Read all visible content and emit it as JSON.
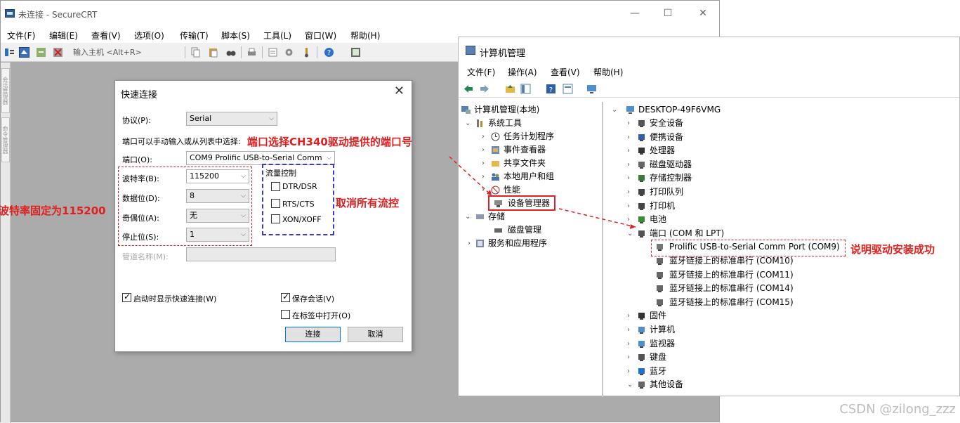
{
  "crt": {
    "title": "未连接 - SecureCRT",
    "window_controls": {
      "minimize": "—",
      "maximize": "☐",
      "close": "✕"
    },
    "menu": [
      "文件(F)",
      "编辑(E)",
      "查看(V)",
      "选项(O)",
      "传输(T)",
      "脚本(S)",
      "工具(L)",
      "窗口(W)",
      "帮助(H)"
    ],
    "host_input_placeholder": "输入主机 <Alt+R>",
    "rail_tabs": [
      "会话管理器",
      "命令管理器"
    ]
  },
  "dialog": {
    "title": "快速连接",
    "close": "✕",
    "protocol_label": "协议(P):",
    "protocol_value": "Serial",
    "port_hint": "端口可以手动输入或从列表中选择:",
    "port_label": "端口(O):",
    "port_value": "COM9 Prolific USB-to-Serial Comm P",
    "baud_label": "波特率(B):",
    "baud_value": "115200",
    "databits_label": "数据位(D):",
    "databits_value": "8",
    "parity_label": "奇偶位(A):",
    "parity_value": "无",
    "stopbits_label": "停止位(S):",
    "stopbits_value": "1",
    "pipe_label": "管道名称(M):",
    "flow_title": "流量控制",
    "flow_options": [
      "DTR/DSR",
      "RTS/CTS",
      "XON/XOFF"
    ],
    "show_on_startup": "启动时显示快速连接(W)",
    "save_session": "保存会话(V)",
    "open_in_tab": "在标签中打开(O)",
    "connect_button": "连接",
    "cancel_button": "取消"
  },
  "annotations": {
    "port_note": "端口选择CH340驱动提供的端口号",
    "baud_note": "波特率固定为115200",
    "flow_note": "取消所有流控",
    "success_note": "说明驱动安装成功"
  },
  "mgmt": {
    "title": "计算机管理",
    "menu": [
      "文件(F)",
      "操作(A)",
      "查看(V)",
      "帮助(H)"
    ],
    "left_tree": [
      "计算机管理(本地)",
      "系统工具",
      "任务计划程序",
      "事件查看器",
      "共享文件夹",
      "本地用户和组",
      "性能",
      "设备管理器",
      "存储",
      "磁盘管理",
      "服务和应用程序"
    ],
    "computer_name": "DESKTOP-49F6VMG",
    "device_tree": [
      "安全设备",
      "便携设备",
      "处理器",
      "磁盘驱动器",
      "存储控制器",
      "打印队列",
      "打印机",
      "电池",
      "端口 (COM 和 LPT)",
      "Prolific USB-to-Serial Comm Port (COM9)",
      "蓝牙链接上的标准串行 (COM10)",
      "蓝牙链接上的标准串行 (COM11)",
      "蓝牙链接上的标准串行 (COM14)",
      "蓝牙链接上的标准串行 (COM15)",
      "固件",
      "计算机",
      "监视器",
      "键盘",
      "蓝牙",
      "其他设备"
    ]
  },
  "watermark": "CSDN @zilong_zzz",
  "colors": {
    "annotation_red": "#e02020",
    "annotation_blue": "#3a3ad0",
    "selection": "#cce4f7"
  }
}
